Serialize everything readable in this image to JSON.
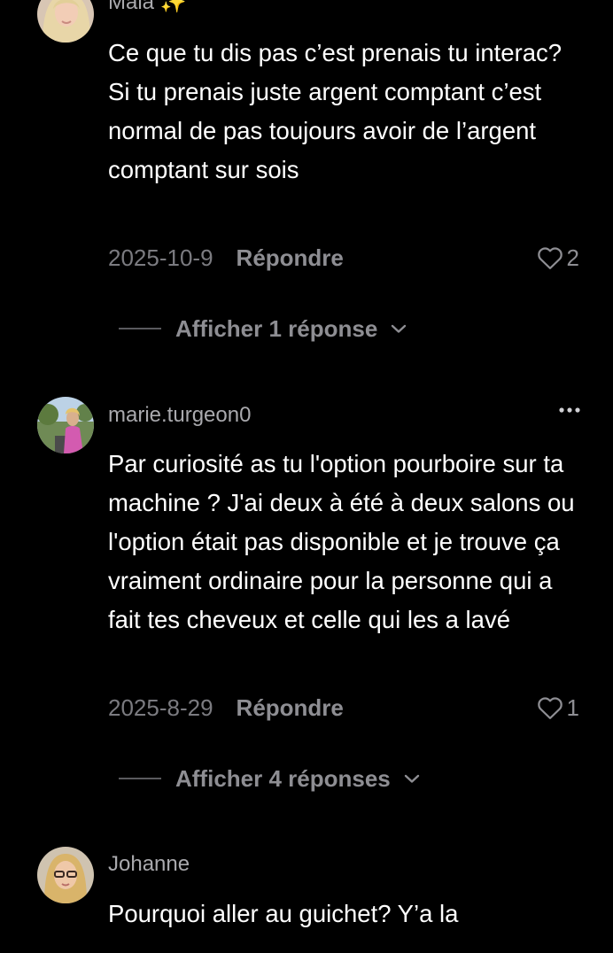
{
  "comments": [
    {
      "username": "Maia ✨",
      "text": "Ce que tu dis pas c’est prenais tu interac? Si tu prenais juste argent comptant c’est normal de pas toujours avoir de l’argent comptant sur sois",
      "date": "2025-10-9",
      "reply_label": "Répondre",
      "likes": "2",
      "show_replies_label": "Afficher 1 réponse"
    },
    {
      "username": "marie.turgeon0",
      "text": "Par curiosité as tu l'option pourboire sur ta machine ? J'ai deux à été à deux salons ou l'option était pas disponible et je trouve ça vraiment ordinaire pour la personne qui a fait tes cheveux et celle qui les a lavé",
      "date": "2025-8-29",
      "reply_label": "Répondre",
      "likes": "1",
      "show_replies_label": "Afficher 4 réponses",
      "more_icon": "more-horizontal-icon"
    },
    {
      "username": "Johanne",
      "text": "Pourquoi aller au guichet? Y’a la"
    }
  ],
  "colors": {
    "background": "#000000",
    "text": "#ffffff",
    "username": "#a9a9ad",
    "secondary": "#8e8e93",
    "date": "#7b7b80"
  },
  "icons": {
    "like": "heart-outline-icon",
    "expand": "chevron-down-icon",
    "more": "more-horizontal-icon"
  }
}
